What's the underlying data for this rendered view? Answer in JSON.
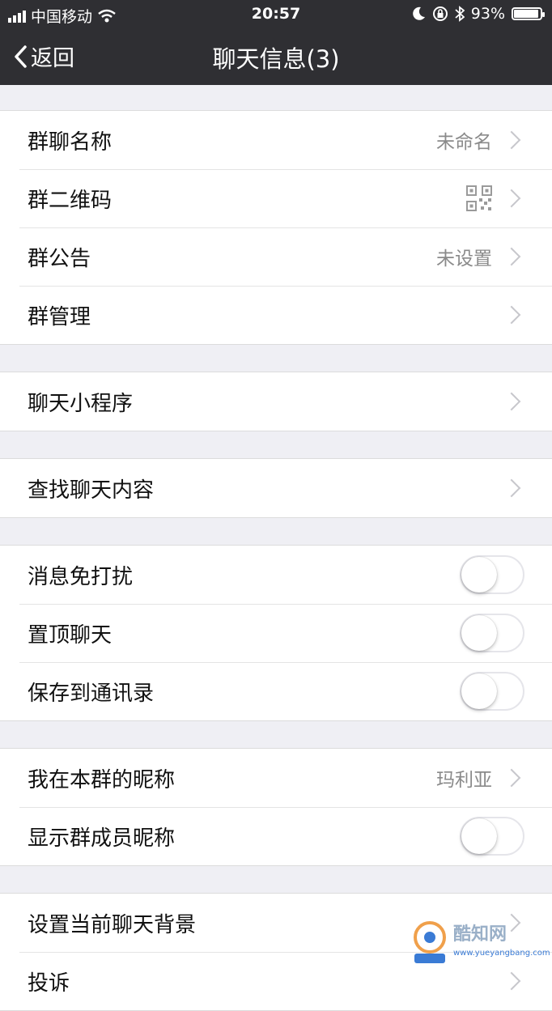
{
  "status_bar": {
    "carrier": "中国移动",
    "time": "20:57",
    "battery": "93%",
    "battery_level": 0.93
  },
  "nav": {
    "back_label": "返回",
    "title": "聊天信息(3)"
  },
  "groups": [
    [
      {
        "label": "群聊名称",
        "value": "未命名"
      },
      {
        "label": "群二维码"
      },
      {
        "label": "群公告",
        "value": "未设置"
      },
      {
        "label": "群管理"
      }
    ],
    [
      {
        "label": "聊天小程序"
      }
    ],
    [
      {
        "label": "查找聊天内容"
      }
    ],
    [
      {
        "label": "消息免打扰",
        "toggle_on": false
      },
      {
        "label": "置顶聊天",
        "toggle_on": false
      },
      {
        "label": "保存到通讯录",
        "toggle_on": false
      }
    ],
    [
      {
        "label": "我在本群的昵称",
        "value": "玛利亚"
      },
      {
        "label": "显示群成员昵称",
        "toggle_on": false
      }
    ],
    [
      {
        "label": "设置当前聊天背景"
      },
      {
        "label": "投诉"
      }
    ]
  ],
  "watermark": {
    "text": "酷知网",
    "sub": "www.yueyangbang.com"
  }
}
